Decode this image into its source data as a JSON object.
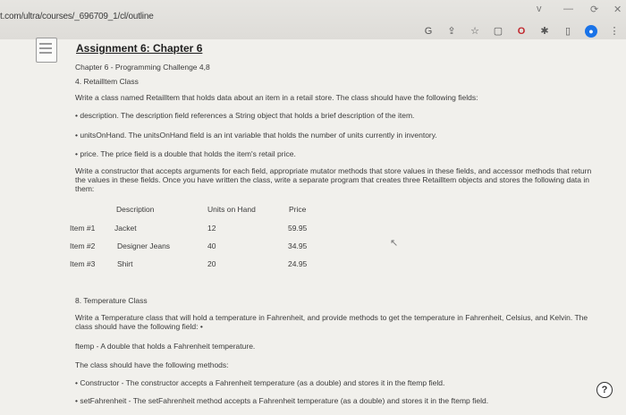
{
  "browser": {
    "url": "t.com/ultra/courses/_696709_1/cl/outline",
    "window_controls": [
      "v",
      "—",
      "⟳",
      "✕"
    ]
  },
  "toolbar": {
    "icons": [
      "google-icon",
      "share-icon",
      "star-icon",
      "extension-icon",
      "opera-icon",
      "puzzle-icon",
      "sidebar-icon",
      "profile-icon",
      "menu-icon"
    ]
  },
  "assignment": {
    "title": "Assignment 6: Chapter 6",
    "subtitle": "Chapter 6 - Programming Challenge 4,8",
    "section4_heading": "4. Retailltem Class",
    "section4_intro": "Write a class named Retailltem that holds data about an item in a retail store. The class should have the following fields:",
    "field_description": "• description. The description field references a String object that holds a brief description of the item.",
    "field_units": "• unitsOnHand. The unitsOnHand field is an int variable that holds the number of units currently in inventory.",
    "field_price": "• price. The price field is a double that holds the item's retail price.",
    "constructor_text": "Write a constructor that accepts arguments for each field, appropriate mutator methods that store values in these fields, and accessor methods that return the values in these fields. Once you have written the class, write a separate program that creates three Retailltem objects and stores the following data in them:",
    "table": {
      "headers": [
        "Description",
        "Units on Hand",
        "Price"
      ],
      "rows": [
        {
          "label": "Item #1",
          "description": "Jacket",
          "units": "12",
          "price": "59.95"
        },
        {
          "label": "Item #2",
          "description": "Designer Jeans",
          "units": "40",
          "price": "34.95"
        },
        {
          "label": "Item #3",
          "description": "Shirt",
          "units": "20",
          "price": "24.95"
        }
      ]
    },
    "section8_heading": "8. Temperature Class",
    "section8_intro": "Write a Temperature class that will hold a temperature in Fahrenheit, and provide methods to get the temperature in Fahrenheit, Celsius, and Kelvin. The class should have the following field: •",
    "ftemp_field": "ftemp - A double that holds a Fahrenheit temperature.",
    "methods_intro": "The class should have the following methods:",
    "method_constructor": "• Constructor - The constructor accepts a Fahrenheit temperature (as a double) and stores it in the ftemp field.",
    "method_set": "• setFahrenheit - The setFahrenheit method accepts a Fahrenheit temperature (as a double) and stores it in the ftemp field."
  },
  "help_label": "?"
}
